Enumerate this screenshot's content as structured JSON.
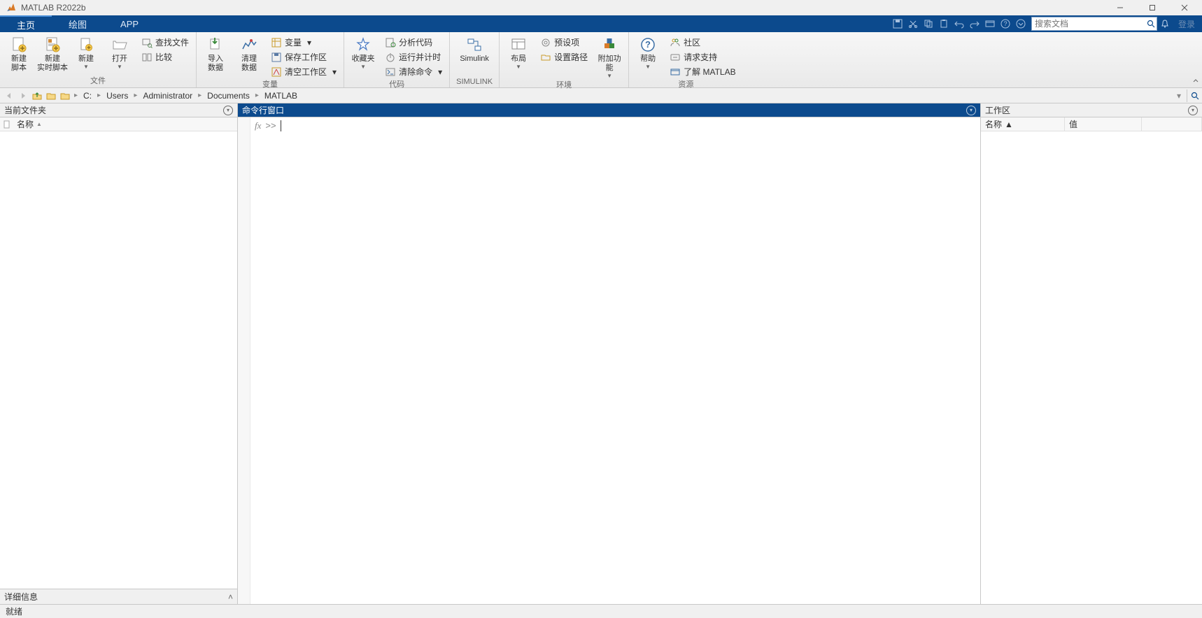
{
  "app": {
    "title": "MATLAB R2022b"
  },
  "tabs": {
    "home": "主页",
    "plot": "绘图",
    "app": "APP"
  },
  "search": {
    "placeholder": "搜索文档"
  },
  "login_label": "登录",
  "ribbon": {
    "groups": {
      "file": {
        "title": "文件",
        "new_script": "新建\n脚本",
        "new_live": "新建\n实时脚本",
        "new": "新建",
        "open": "打开",
        "find_files": "查找文件",
        "compare": "比较"
      },
      "variable": {
        "title": "变量",
        "import": "导入\n数据",
        "clean": "清理\n数据",
        "variable_menu": "变量",
        "save_ws": "保存工作区",
        "clear_ws": "清空工作区"
      },
      "code": {
        "title": "代码",
        "favorites": "收藏夹",
        "analyze": "分析代码",
        "run_time": "运行并计时",
        "clear_cmd": "清除命令"
      },
      "simulink": {
        "title": "SIMULINK",
        "simulink": "Simulink"
      },
      "env": {
        "title": "环境",
        "layout": "布局",
        "prefs": "预设项",
        "set_path": "设置路径",
        "addons": "附加功能"
      },
      "res": {
        "title": "资源",
        "help": "帮助",
        "community": "社区",
        "support": "请求支持",
        "learn": "了解 MATLAB"
      }
    }
  },
  "path": {
    "drive": "C:",
    "segments": [
      "Users",
      "Administrator",
      "Documents",
      "MATLAB"
    ]
  },
  "panels": {
    "current_folder": "当前文件夹",
    "command_window": "命令行窗口",
    "workspace": "工作区",
    "details": "详细信息"
  },
  "cols": {
    "name": "名称",
    "value": "值"
  },
  "cmd": {
    "fx": "fx",
    "prompt": ">>"
  },
  "status": {
    "ready": "就绪"
  }
}
